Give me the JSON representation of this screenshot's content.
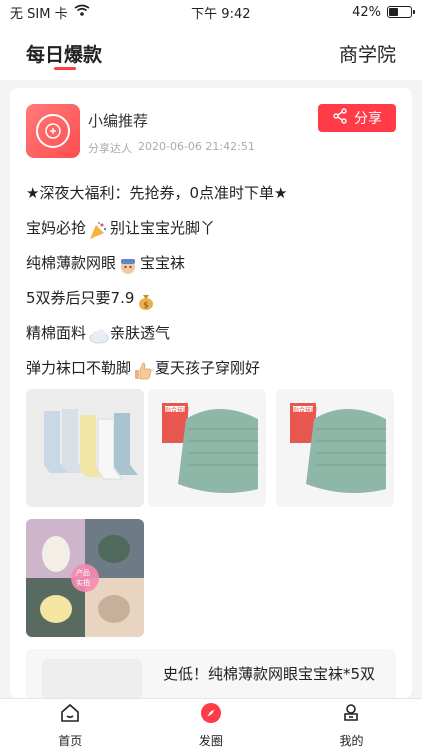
{
  "status": {
    "carrier": "无 SIM 卡",
    "time": "下午 9:42",
    "battery": "42%",
    "battery_level": 0.42
  },
  "nav": {
    "main_tab": "每日爆款",
    "secondary_tab": "商学院"
  },
  "post": {
    "author_name": "小编推荐",
    "author_role": "分享达人",
    "timestamp": "2020-06-06 21:42:51",
    "share_label": "分享",
    "lines": [
      "★深夜大福利：先抢券，0点准时下单★",
      "宝妈必抢",
      "别让宝宝光脚丫",
      "纯棉薄款网眼",
      "宝宝袜",
      "5双券后只要7.9",
      "精棉面料",
      "亲肤透气",
      "弹力袜口不勒脚",
      "夏天孩子穿刚好"
    ],
    "image_labels": [
      "产品",
      "实拍"
    ],
    "tag_label": "贴合袜跟"
  },
  "product": {
    "title": "史低！纯棉薄款网眼宝宝袜*5双"
  },
  "tabbar": {
    "items": [
      {
        "label": "首页",
        "icon": "home-icon"
      },
      {
        "label": "发圈",
        "icon": "compass-icon"
      },
      {
        "label": "我的",
        "icon": "profile-icon"
      }
    ]
  },
  "colors": {
    "accent": "#ff3b48",
    "text": "#222222",
    "muted": "#aaaaaa"
  }
}
